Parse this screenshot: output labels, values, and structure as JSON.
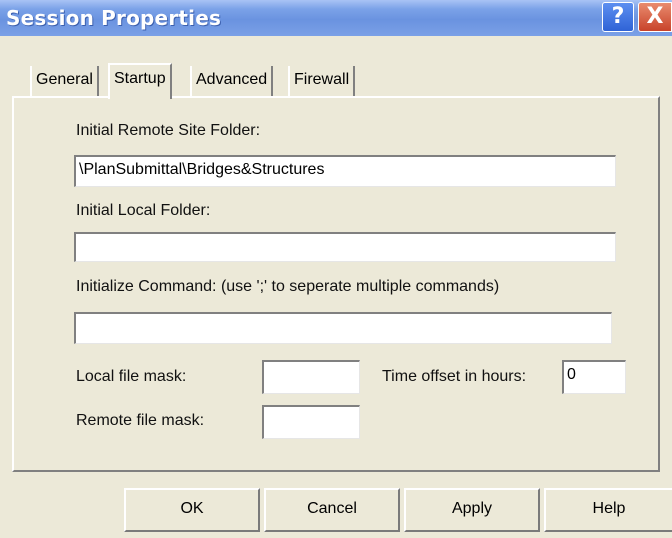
{
  "window": {
    "title": "Session Properties",
    "help_glyph": "?",
    "close_glyph": "X"
  },
  "tabs": [
    {
      "label": "General",
      "active": false
    },
    {
      "label": "Startup",
      "active": true
    },
    {
      "label": "Advanced",
      "active": false
    },
    {
      "label": "Firewall",
      "active": false
    }
  ],
  "startup": {
    "remote_folder_label": "Initial Remote Site Folder:",
    "remote_folder_value": "\\PlanSubmittal\\Bridges&Structures",
    "local_folder_label": "Initial Local Folder:",
    "local_folder_value": "",
    "init_command_label": "Initialize Command: (use ';' to seperate multiple commands)",
    "init_command_value": "",
    "local_mask_label": "Local file mask:",
    "local_mask_value": "",
    "remote_mask_label": "Remote file mask:",
    "remote_mask_value": "",
    "time_offset_label": "Time offset in hours:",
    "time_offset_value": "0"
  },
  "buttons": {
    "ok": "OK",
    "cancel": "Cancel",
    "apply": "Apply",
    "help": "Help"
  },
  "colors": {
    "titlebar": "#6a93e0",
    "dialog_bg": "#ece9d8",
    "close_button": "#c8432a"
  }
}
